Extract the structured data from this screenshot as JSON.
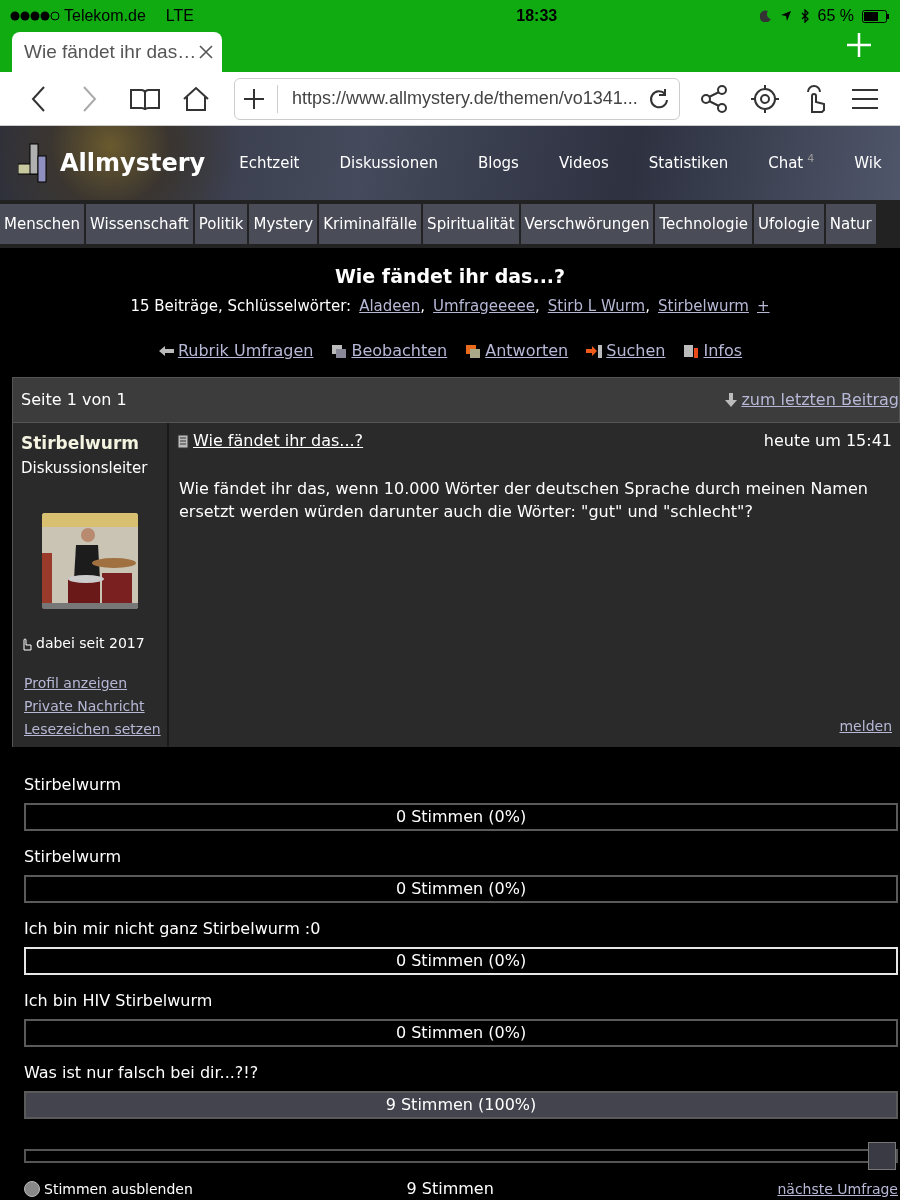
{
  "status_bar": {
    "carrier": "Telekom.de",
    "network": "LTE",
    "time": "18:33",
    "battery": "65 %"
  },
  "browser": {
    "tab": {
      "title": "Wie fändet ihr das…",
      "selected": true
    },
    "url": "https://www.allmystery.de/themen/vo1341..."
  },
  "site": {
    "logo": "Allmystery",
    "nav": [
      {
        "label": "Echtzeit"
      },
      {
        "label": "Diskussionen"
      },
      {
        "label": "Blogs"
      },
      {
        "label": "Videos"
      },
      {
        "label": "Statistiken"
      },
      {
        "label": "Chat",
        "badge": "4"
      },
      {
        "label": "Wik"
      }
    ],
    "categories": [
      "Menschen",
      "Wissenschaft",
      "Politik",
      "Mystery",
      "Kriminalfälle",
      "Spiritualität",
      "Verschwörungen",
      "Technologie",
      "Ufologie",
      "Natur"
    ]
  },
  "thread": {
    "title": "Wie fändet ihr das...?",
    "meta": "15 Beiträge, Schlüsselwörter:",
    "keywords": [
      {
        "label": "Aladeen",
        "suffix": ","
      },
      {
        "label": "Umfrageeeee",
        "suffix": ","
      },
      {
        "label": "Stirb L Wurm",
        "suffix": ","
      },
      {
        "label": "Stirbelwurm"
      }
    ],
    "more": "+",
    "actions": [
      {
        "kind": "back",
        "label": "Rubrik Umfragen"
      },
      {
        "kind": "watch",
        "label": "Beobachten"
      },
      {
        "kind": "reply",
        "label": "Antworten"
      },
      {
        "kind": "search",
        "label": "Suchen"
      },
      {
        "kind": "info",
        "label": "Infos"
      }
    ]
  },
  "pagination": {
    "label": "Seite 1 von 1",
    "jump": "zum letzten Beitrag"
  },
  "post": {
    "author": "Stirbelwurm",
    "role": "Diskussionsleiter",
    "since": "dabei seit 2017",
    "links": [
      "Profil anzeigen",
      "Private Nachricht",
      "Lesezeichen setzen"
    ],
    "title": "Wie fändet ihr das...?",
    "time": "heute um 15:41",
    "body": "Wie fändet ihr das, wenn 10.000 Wörter der deutschen Sprache durch meinen Namen ersetzt werden würden darunter auch die Wörter: \"gut\" und \"schlecht\"?",
    "report": "melden"
  },
  "poll": {
    "options": [
      {
        "label": "Stirbelwurm",
        "result": "0 Stimmen (0%)",
        "selected": false
      },
      {
        "label": "Stirbelwurm",
        "result": "0 Stimmen (0%)",
        "selected": false
      },
      {
        "label": "Ich bin mir nicht ganz Stirbelwurm :0",
        "result": "0 Stimmen (0%)",
        "selected": true
      },
      {
        "label": "Ich bin HIV Stirbelwurm",
        "result": "0 Stimmen (0%)",
        "selected": false
      },
      {
        "label": "Was ist nur falsch bei dir...?!?",
        "result": "9 Stimmen (100%)",
        "level": 1,
        "selected": false
      }
    ],
    "slider": {
      "level": 1
    },
    "hide_votes": {
      "label": "Stimmen ausblenden",
      "checked": false
    },
    "total": "9 Stimmen",
    "next": "nächste Umfrage"
  }
}
